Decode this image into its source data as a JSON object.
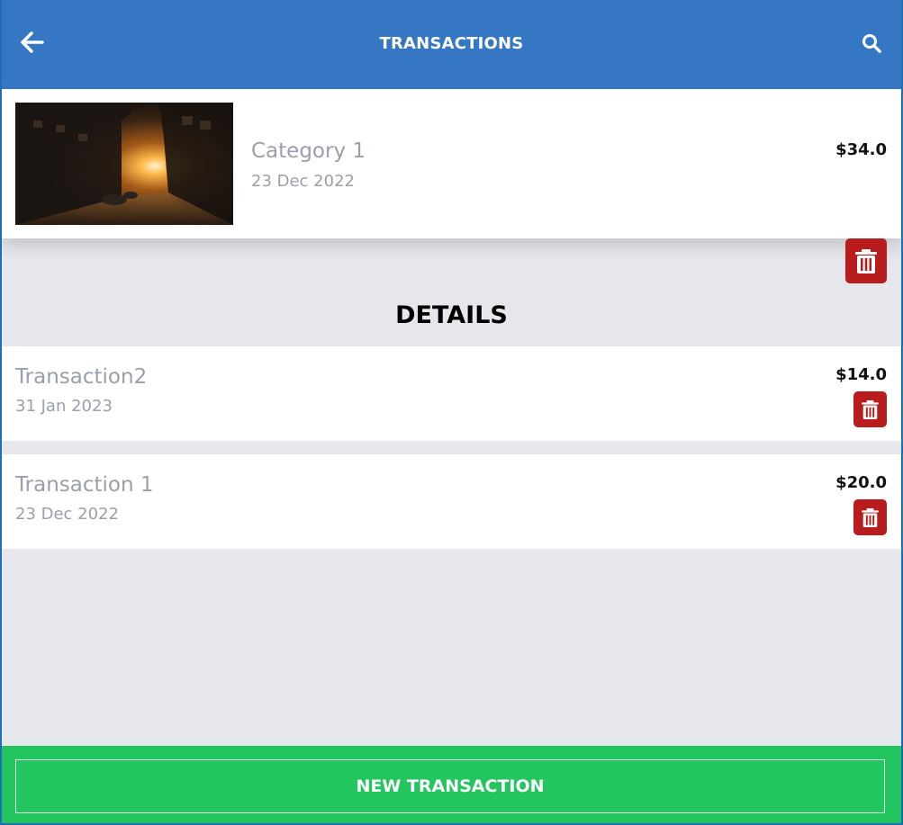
{
  "header": {
    "title": "TRANSACTIONS",
    "back_icon": "arrow-left-icon",
    "search_icon": "search-icon",
    "background_color": "#3577c2"
  },
  "category": {
    "name": "Category 1",
    "date": "23 Dec 2022",
    "amount": "$34.0",
    "image": "sunset-city-street"
  },
  "details": {
    "title": "DETAILS"
  },
  "transactions": [
    {
      "name": "Transaction2",
      "date": "31 Jan 2023",
      "amount": "$14.0"
    },
    {
      "name": "Transaction 1",
      "date": "23 Dec 2022",
      "amount": "$20.0"
    }
  ],
  "footer": {
    "new_button_label": "NEW TRANSACTION",
    "background_color": "#22c55e"
  },
  "colors": {
    "delete": "#b91c1c",
    "muted_text": "#9aa0aa",
    "page_background": "#e5e7eb"
  }
}
